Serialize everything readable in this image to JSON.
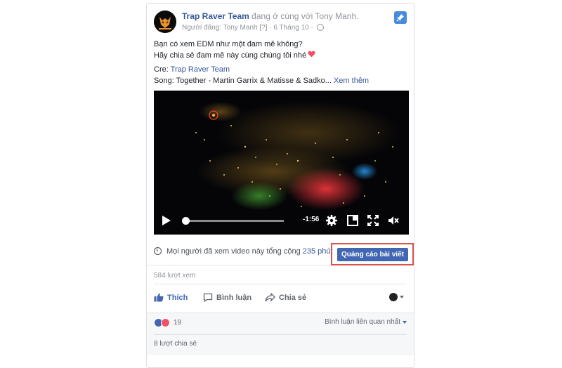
{
  "post": {
    "page_name": "Trap Raver Team",
    "with_text": "đang ở cùng với",
    "tagged_name": "Tony Manh.",
    "meta": "Người đăng: Tony Manh [?] · 6 Tháng 10 ·",
    "caption_line1": "Bạn có xem EDM như một đam mê không?",
    "caption_line2": "Hãy chia sẻ đam mê này cùng chúng tôi nhé",
    "credit_label": "Cre:",
    "credit_link": "Trap Raver Team",
    "song_text": "Song: Together - Martin Garrix & Matisse & Sadko...",
    "see_more": "Xem thêm"
  },
  "video": {
    "time_remaining": "-1:56",
    "progress": 0.02
  },
  "stats": {
    "watch_text": "Mọi người đã xem video này tổng cộng",
    "watch_minutes": "235 phút",
    "boost_button": "Quảng cáo bài viết",
    "views": "584 lượt xem"
  },
  "actions": {
    "like": "Thích",
    "comment": "Bình luận",
    "share": "Chia sẻ"
  },
  "reactions": {
    "count": "19",
    "sort_label": "Bình luận liên quan nhất",
    "shares": "8 lượt chia sẻ"
  },
  "colors": {
    "link": "#365899",
    "boost": "#4267b2",
    "highlight_border": "#d9534f"
  },
  "icons": [
    "pin-icon",
    "globe-icon",
    "heart-icon",
    "play-icon",
    "settings-icon",
    "pip-icon",
    "fullscreen-icon",
    "mute-icon",
    "clock-icon",
    "like-icon",
    "comment-icon",
    "share-icon"
  ]
}
